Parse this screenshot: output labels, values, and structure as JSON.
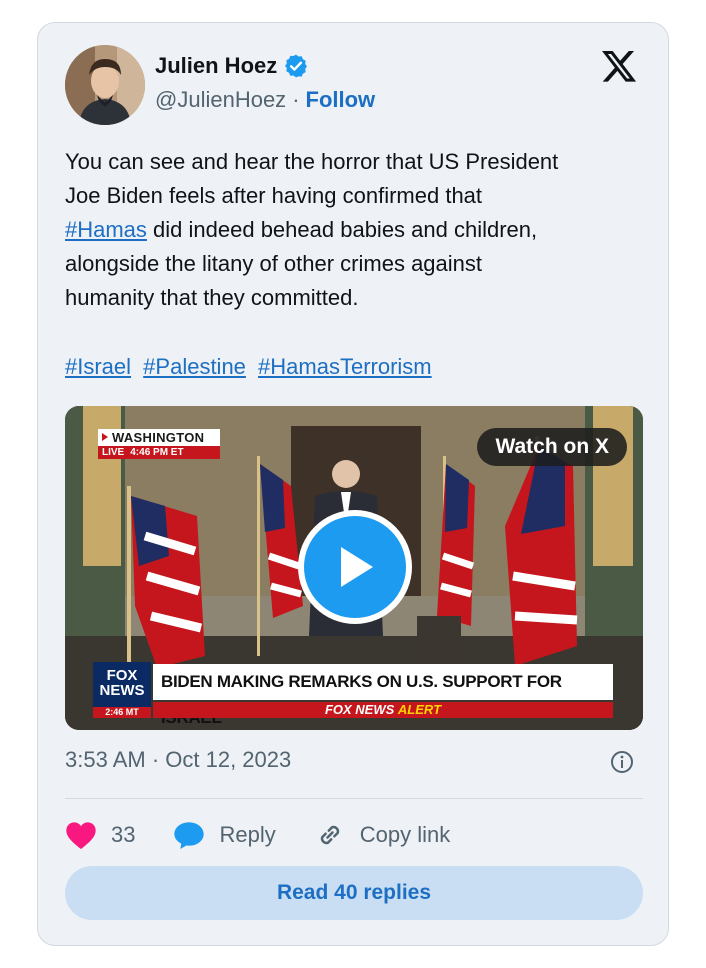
{
  "author": {
    "name": "Julien Hoez",
    "handle": "@JulienHoez",
    "separator": "·",
    "follow_label": "Follow"
  },
  "tweet": {
    "line_1": "You can see and hear the horror that US President",
    "line_2": "Joe Biden feels after having confirmed that",
    "hashtag_inline": "#Hamas",
    "line_3_rest": "did indeed behead babies and children,",
    "line_4": "alongside the litany of other crimes against",
    "line_5": "humanity that they committed.",
    "hashtags": [
      "#Israel",
      "#Palestine",
      "#HamasTerrorism"
    ]
  },
  "media": {
    "watch_label": "Watch on X",
    "live_city": "WASHINGTON",
    "live_label": "LIVE",
    "live_time": "4:46 PM ET",
    "network_logo_top": "FOX",
    "network_logo_bottom": "NEWS",
    "network_time": "2:46 MT",
    "headline": "BIDEN MAKING REMARKS ON U.S. SUPPORT FOR ISRAEL",
    "alert_prefix": "FOX NEWS",
    "alert_word": "ALERT"
  },
  "meta": {
    "timestamp": "3:53 AM · Oct 12, 2023"
  },
  "actions": {
    "like_count": "33",
    "reply_label": "Reply",
    "copy_label": "Copy link"
  },
  "read_replies_label": "Read 40 replies",
  "colors": {
    "link": "#1d6fc4",
    "like": "#f91880",
    "reply_icon": "#1d9bf0",
    "card_bg": "#eef1f5",
    "read_btn_bg": "#c9def3"
  },
  "icons": [
    "verified-badge-icon",
    "x-logo-icon",
    "play-icon",
    "info-icon",
    "heart-icon",
    "reply-bubble-icon",
    "link-icon"
  ]
}
